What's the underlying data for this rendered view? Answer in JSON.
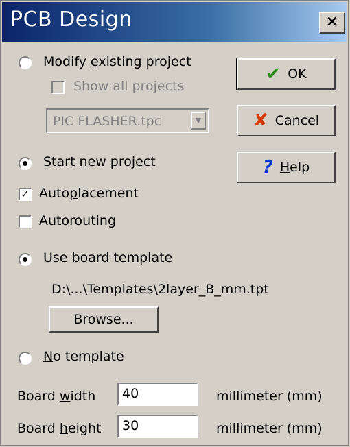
{
  "window": {
    "title": "PCB Design",
    "close_symbol": "×"
  },
  "options": {
    "modify_existing": "Modify existing project",
    "show_all_projects": "Show all projects",
    "project_combo_value": "PIC FLASHER.tpc",
    "start_new": "Start new project",
    "autoplacement": "Autoplacement",
    "autorouting": "Autorouting",
    "use_template": "Use board template",
    "template_path": "D:\\...\\Templates\\2layer_B_mm.tpt",
    "browse": "Browse...",
    "no_template": "No template"
  },
  "state": {
    "modify_existing_selected": false,
    "start_new_selected": true,
    "autoplacement_checked": true,
    "autorouting_checked": false,
    "use_template_selected": true,
    "no_template_selected": false
  },
  "buttons": {
    "ok": "OK",
    "cancel": "Cancel",
    "help": "Help"
  },
  "board": {
    "width_label": "Board width",
    "width_value": "40",
    "width_unit": "millimeter (mm)",
    "height_label": "Board height",
    "height_value": "30",
    "height_unit": "millimeter (mm)"
  },
  "colors": {
    "title_start": "#0a246a",
    "title_end": "#a6caf0",
    "face": "#d4d0c8",
    "ok_check": "#2a8a1a",
    "cancel_x": "#d43a00",
    "help_q": "#0033cc"
  }
}
